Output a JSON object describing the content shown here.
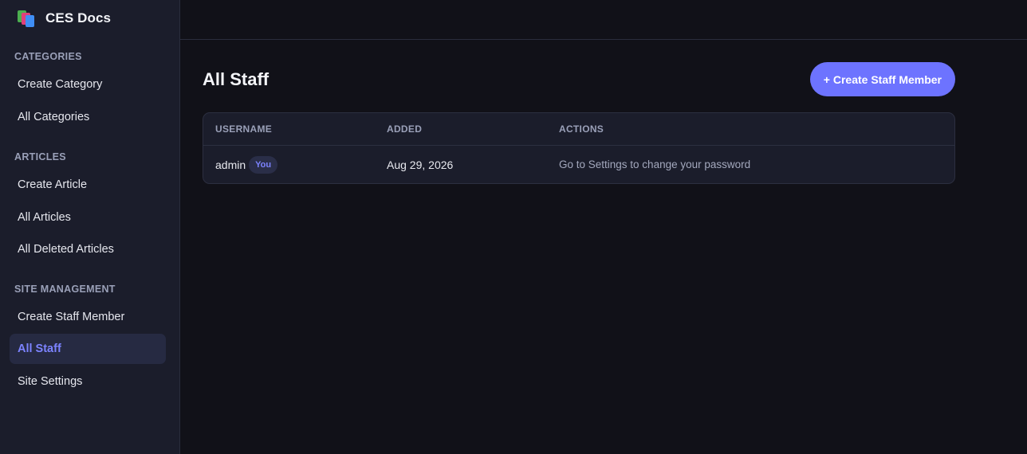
{
  "brand": {
    "title": "CES Docs",
    "logo_icon": "books-icon"
  },
  "sidebar": {
    "sections": [
      {
        "title": "CATEGORIES",
        "items": [
          {
            "label": "Create Category"
          },
          {
            "label": "All Categories"
          }
        ]
      },
      {
        "title": "ARTICLES",
        "items": [
          {
            "label": "Create Article"
          },
          {
            "label": "All Articles"
          },
          {
            "label": "All Deleted Articles"
          }
        ]
      },
      {
        "title": "SITE MANAGEMENT",
        "items": [
          {
            "label": "Create Staff Member"
          },
          {
            "label": "All Staff",
            "active": true
          },
          {
            "label": "Site Settings"
          }
        ]
      }
    ]
  },
  "main": {
    "title": "All Staff",
    "create_button_label": "+ Create Staff Member",
    "table": {
      "headers": {
        "username": "USERNAME",
        "added": "ADDED",
        "actions": "ACTIONS"
      },
      "rows": [
        {
          "username": "admin",
          "badge": "You",
          "added": "Aug 29, 2026",
          "actions": "Go to Settings to change your password"
        }
      ]
    }
  },
  "colors": {
    "accent": "#6d73ff",
    "active_text": "#7c83ff",
    "sidebar_bg": "#1b1d2b",
    "page_bg": "#111118"
  }
}
